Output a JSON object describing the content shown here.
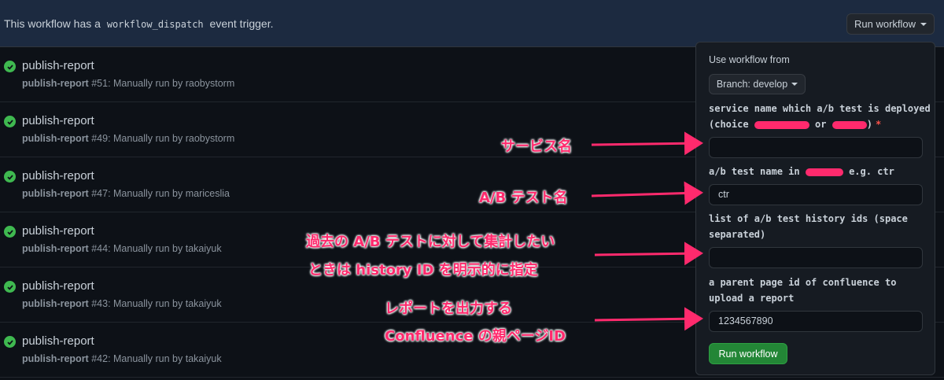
{
  "banner": {
    "text_before": "This workflow has a",
    "code": "workflow_dispatch",
    "text_after": "event trigger.",
    "run_button": "Run workflow"
  },
  "runs": [
    {
      "title": "publish-report",
      "name": "publish-report",
      "number": "#51",
      "desc": ": Manually run by raobystorm"
    },
    {
      "title": "publish-report",
      "name": "publish-report",
      "number": "#49",
      "desc": ": Manually run by raobystorm"
    },
    {
      "title": "publish-report",
      "name": "publish-report",
      "number": "#47",
      "desc": ": Manually run by mariceslia"
    },
    {
      "title": "publish-report",
      "name": "publish-report",
      "number": "#44",
      "desc": ": Manually run by takaiyuk"
    },
    {
      "title": "publish-report",
      "name": "publish-report",
      "number": "#43",
      "desc": ": Manually run by takaiyuk"
    },
    {
      "title": "publish-report",
      "name": "publish-report",
      "number": "#42",
      "desc": ": Manually run by takaiyuk"
    }
  ],
  "panel": {
    "use_from_label": "Use workflow from",
    "branch_button": "Branch: develop",
    "fields": [
      {
        "label_line1": "service name which a/b test is deployed",
        "label_line2_prefix": "(choice",
        "label_line2_mid": "or",
        "label_line2_suffix": ")",
        "required": "*",
        "value": ""
      },
      {
        "label_prefix": "a/b test name in",
        "label_suffix": "e.g. ctr",
        "value": "ctr"
      },
      {
        "label_line1": "list of a/b test history ids (space",
        "label_line2": "separated)",
        "value": ""
      },
      {
        "label_line1": "a parent page id of confluence to",
        "label_line2": "upload a report",
        "value": "1234567890"
      }
    ],
    "submit_button": "Run workflow"
  },
  "annotations": {
    "service": "サービス名",
    "abtest": "A/B テスト名",
    "history_line1": "過去の A/B テストに対して集計したい",
    "history_line2": "ときは history ID を明示的に指定",
    "confluence_line1": "レポートを出力する",
    "confluence_line2": "Confluence の親ページID"
  },
  "colors": {
    "annotation": "#ff2a6d",
    "success": "#3fb950",
    "submit": "#238636"
  }
}
